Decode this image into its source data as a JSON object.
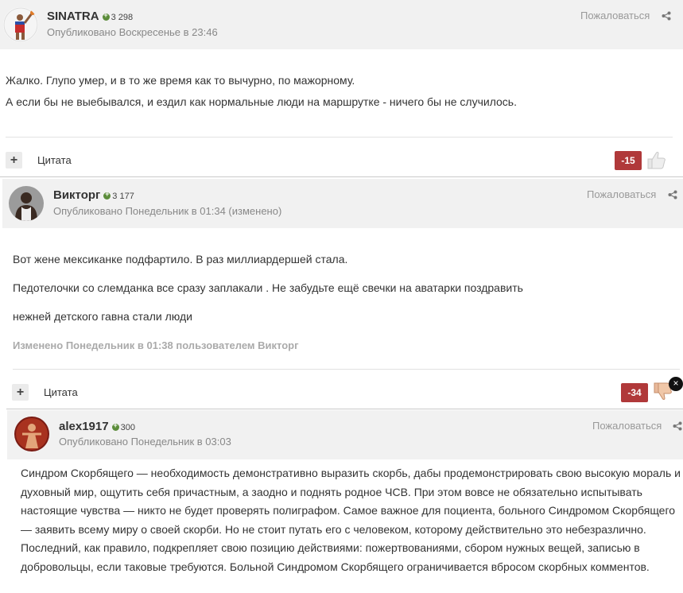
{
  "posts": [
    {
      "author": "SINATRA",
      "reputation": "3 298",
      "published": "Опубликовано Воскресенье в 23:46",
      "report": "Пожаловаться",
      "lines": [
        "Жалко. Глупо умер, и в то же время как то вычурно, по мажорному.",
        "А если бы не выебывался, и ездил как нормальные люди на маршрутке - ничего бы не случилось."
      ],
      "quote_label": "Цитата",
      "score": "-15"
    },
    {
      "author": "Викторг",
      "reputation": "3 177",
      "published": "Опубликовано Понедельник в 01:34 (изменено)",
      "report": "Пожаловаться",
      "lines": [
        "Вот жене мексиканке подфартило. В раз миллиардершей стала.",
        "Педотелочки со слемданка все сразу заплакали . Не забудьте ещё свечки на аватарки поздравить",
        "нежней детского гавна стали люди"
      ],
      "edited": "Изменено Понедельник в 01:38 пользователем Викторг",
      "quote_label": "Цитата",
      "score": "-34",
      "close": "×"
    },
    {
      "author": "alex1917",
      "reputation": "300",
      "published": "Опубликовано Понедельник в 03:03",
      "report": "Пожаловаться",
      "lines": [
        "Синдром Скорбящего — необходимость демонстративно выразить скорбь, дабы продемонстрировать свою высокую мораль и",
        "духовный мир, ощутить себя причастным, а заодно и поднять родное ЧСВ. При этом вовсе не обязательно испытывать",
        "настоящие чувства — никто не будет проверять полиграфом. Самое важное для поциента, больного Синдромом Скорбящего",
        "— заявить всему миру о своей скорби. Но не стоит путать его с человеком, которому действительно это небезразлично.",
        "Последний, как правило, подкрепляет свою позицию действиями: пожертвованиями, сбором нужных вещей, записью в",
        "добровольцы, если таковые требуются. Больной Синдромом Скорбящего ограничивается вбросом скорбных комментов."
      ]
    }
  ],
  "icons": {
    "reputation": "plus-circle-icon",
    "share": "share-icon",
    "thumb_up": "thumbs-up-icon",
    "thumb_down": "thumbs-down-icon"
  },
  "colors": {
    "header_bg": "#f1f1f1",
    "score_bg": "#b0393a",
    "rep_green": "#5b8c3a"
  }
}
